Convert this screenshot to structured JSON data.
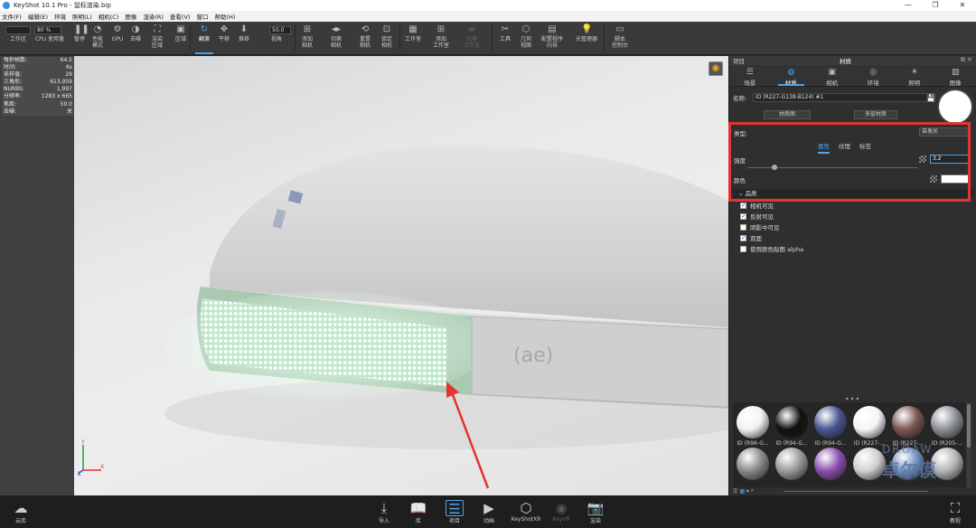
{
  "window": {
    "title": "KeyShot 10.1 Pro  - 鼠标渲染.bip",
    "controls": [
      "—",
      "❐",
      "✕"
    ]
  },
  "menu": [
    "文件(F)",
    "编辑(E)",
    "环境",
    "照明(L)",
    "相机(C)",
    "图像",
    "渲染(R)",
    "查看(V)",
    "窗口",
    "帮助(H)"
  ],
  "toolbar": {
    "items": [
      {
        "label": "工作区",
        "icon": "workspace-icon"
      },
      {
        "label": "CPU 使用量",
        "icon": "cpu-icon"
      },
      {
        "label": "暂停",
        "icon": "pause-icon"
      },
      {
        "label": "性能\n模式",
        "icon": "performance-icon"
      },
      {
        "label": "GPU",
        "icon": "gpu-icon"
      },
      {
        "label": "去噪",
        "icon": "denoise-icon"
      },
      {
        "label": "渲染\n区域",
        "icon": "region-icon"
      },
      {
        "label": "区域",
        "icon": "area-icon"
      },
      {
        "label": "翻滚",
        "icon": "tumble-icon"
      },
      {
        "label": "平移",
        "icon": "pan-icon"
      },
      {
        "label": "推移",
        "icon": "dolly-icon"
      },
      {
        "label": "视角",
        "icon": "fov-icon"
      },
      {
        "label": "添加\n相机",
        "icon": "add-camera-icon"
      },
      {
        "label": "切换\n相机",
        "icon": "switch-camera-icon"
      },
      {
        "label": "重置\n相机",
        "icon": "reset-camera-icon"
      },
      {
        "label": "锁定\n相机",
        "icon": "lock-camera-icon"
      },
      {
        "label": "工作室",
        "icon": "studio-icon"
      },
      {
        "label": "添加\n工作室",
        "icon": "add-studio-icon"
      },
      {
        "label": "切换\n工作室",
        "icon": "switch-studio-icon"
      },
      {
        "label": "工具",
        "icon": "tools-icon"
      },
      {
        "label": "几何\n视图",
        "icon": "geometry-view-icon"
      },
      {
        "label": "配置程序\n向导",
        "icon": "configurator-icon"
      },
      {
        "label": "光管理器",
        "icon": "light-manager-icon"
      },
      {
        "label": "脚本\n控制台",
        "icon": "script-console-icon"
      }
    ],
    "cpu_value": "80 %",
    "fov_value": "50.0"
  },
  "stats": [
    {
      "k": "每秒帧数:",
      "v": "64.5"
    },
    {
      "k": "时间:",
      "v": "6s"
    },
    {
      "k": "采样值:",
      "v": "29"
    },
    {
      "k": "三角形:",
      "v": "613,959"
    },
    {
      "k": "NURBS:",
      "v": "1,997"
    },
    {
      "k": "分辨率:",
      "v": "1283 x 665"
    },
    {
      "k": "焦距:",
      "v": "50.0"
    },
    {
      "k": "去噪:",
      "v": "关"
    }
  ],
  "panel": {
    "left_title": "项目",
    "title": "材质",
    "tabs": [
      {
        "label": "场景",
        "icon": "scene-icon"
      },
      {
        "label": "材质",
        "icon": "material-icon"
      },
      {
        "label": "相机",
        "icon": "camera-icon"
      },
      {
        "label": "环境",
        "icon": "environment-icon"
      },
      {
        "label": "照明",
        "icon": "lighting-icon"
      },
      {
        "label": "图像",
        "icon": "image-icon"
      }
    ],
    "name_label": "名称:",
    "name_value": "ID (R227-G138-B124) #1",
    "btn_graph": "材质图",
    "btn_multi": "多层材质",
    "type_label": "类型:",
    "type_value": "自发光",
    "subtabs": [
      "属性",
      "纹理",
      "标签"
    ],
    "intensity_label": "强度",
    "intensity_value": "3.2",
    "intensity_fraction": 0.16,
    "color_label": "颜色",
    "color_value": "#ffffff",
    "section": "品质",
    "checks": [
      {
        "label": "相机可见",
        "checked": true
      },
      {
        "label": "反射可见",
        "checked": true
      },
      {
        "label": "阴影中可见",
        "checked": false
      },
      {
        "label": "双面",
        "checked": true
      },
      {
        "label": "使用颜色贴图 alpha",
        "checked": false
      }
    ]
  },
  "library": {
    "materials": [
      {
        "label": "ID (R96-G...",
        "color": "#f2f2f2"
      },
      {
        "label": "ID (R94-G...",
        "color": "#111111"
      },
      {
        "label": "ID (R94-G...",
        "color": "#4a5590"
      },
      {
        "label": "ID (R227-...",
        "color": "#f6f6f6"
      },
      {
        "label": "ID (R227-...",
        "color": "#7a5552"
      },
      {
        "label": "ID (R205-...",
        "color": "#8c9096"
      },
      {
        "label": "",
        "color": "#8a8a8a"
      },
      {
        "label": "",
        "color": "#9a9a9a"
      },
      {
        "label": "",
        "color": "#8a4fb0"
      },
      {
        "label": "",
        "color": "#d0d0d0"
      },
      {
        "label": "",
        "color": "#6d8fbf"
      },
      {
        "label": "",
        "color": "#b5b5b5"
      }
    ]
  },
  "viewport": {
    "emblem": "(ae)",
    "axis": {
      "y": "Y",
      "x": "X",
      "z": "Z"
    }
  },
  "bottom": {
    "left": {
      "label": "云库",
      "icon": "cloud-library-icon"
    },
    "items": [
      {
        "label": "导入",
        "icon": "import-icon"
      },
      {
        "label": "库",
        "icon": "library-icon"
      },
      {
        "label": "项目",
        "icon": "project-icon"
      },
      {
        "label": "动画",
        "icon": "animation-icon"
      },
      {
        "label": "KeyShotXR",
        "icon": "keyshotxr-icon"
      },
      {
        "label": "KeyVR",
        "icon": "keyvr-icon"
      },
      {
        "label": "渲染",
        "icon": "render-icon"
      }
    ],
    "right": {
      "label": "教程",
      "icon": "tutorial-icon"
    }
  },
  "watermark": {
    "en": "DROAW",
    "cn": "卓尔谟"
  },
  "colors": {
    "accent": "#4aa3f0",
    "highlight": "#e53232",
    "glow": "#eafff1",
    "housing": "#d4d4d4"
  }
}
